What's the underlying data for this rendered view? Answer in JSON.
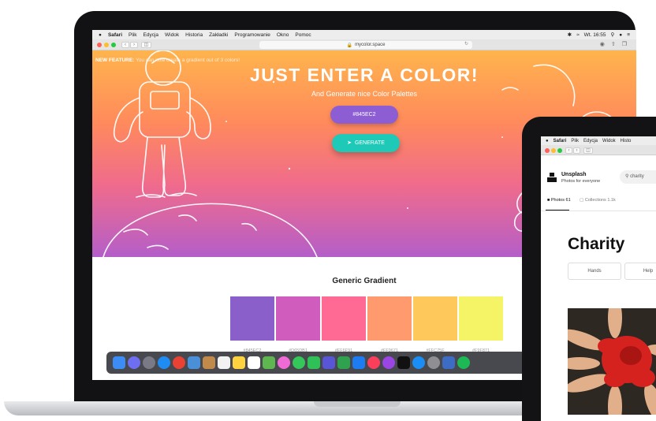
{
  "laptop": {
    "menubar": {
      "apple": "",
      "app": "Safari",
      "items": [
        "Plik",
        "Edycja",
        "Widok",
        "Historia",
        "Zakładki",
        "Programowanie",
        "Okno",
        "Pomoc"
      ],
      "clock": "Wt. 16:55"
    },
    "url": "mycolor.space",
    "announcement": {
      "prefix": "NEW FEATURE:",
      "text": "You can now create a gradient out of 3 colors!"
    },
    "hero": {
      "title": "JUST ENTER A COLOR!",
      "subtitle": "And Generate nice Color Palettes",
      "color_input": "#845EC2",
      "generate_label": "GENERATE"
    },
    "palette": {
      "title": "Generic Gradient",
      "swatches": [
        {
          "hex": "#845EC2",
          "color": "#8b5fc9"
        },
        {
          "hex": "#D65DB1",
          "color": "#d05cbe"
        },
        {
          "hex": "#FF6F91",
          "color": "#ff6a94"
        },
        {
          "hex": "#FF9671",
          "color": "#ff9a6f"
        },
        {
          "hex": "#FFC75F",
          "color": "#ffc85a"
        },
        {
          "hex": "#F9F871",
          "color": "#f4f466"
        }
      ]
    }
  },
  "tablet": {
    "menubar": {
      "app": "Safari",
      "items": [
        "Plik",
        "Edycja",
        "Widok",
        "Histo"
      ]
    },
    "brand": "Unsplash",
    "tagline": "Photos for everyone",
    "search_query": "charity",
    "tabs": {
      "photos": "Photos 61",
      "collections": "Collections 1.1k"
    },
    "heading": "Charity",
    "chips": [
      "Hands",
      "Help"
    ]
  }
}
